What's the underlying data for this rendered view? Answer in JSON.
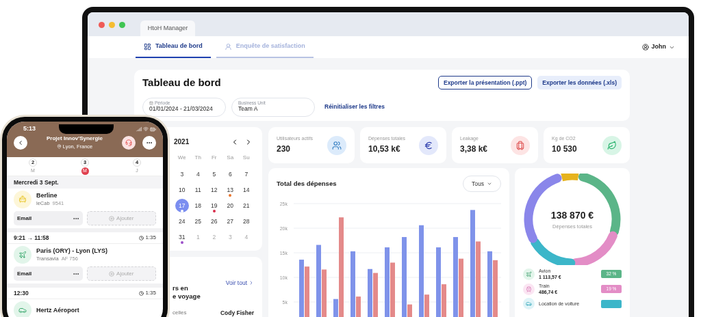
{
  "laptop": {
    "window_tab": "HtoH Manager",
    "nav_tabs": [
      {
        "label": "Tableau de bord",
        "selected": true
      },
      {
        "label": "Enquête de satisfaction",
        "selected": false
      }
    ],
    "user": "John",
    "header": {
      "title": "Tableau de bord",
      "buttons": [
        {
          "label": "Exporter la présentation (.ppt)",
          "kind": "outline"
        },
        {
          "label": "Exporter les données (.xls)",
          "kind": "soft"
        }
      ],
      "filters": [
        {
          "label": "Période",
          "value": "01/01/2024 - 21/03/2024"
        },
        {
          "label": "Business Unit",
          "value": "Team A"
        }
      ],
      "reset": "Réinitialiser les filtres"
    },
    "calendar": {
      "year": "2021",
      "weekdays": [
        "We",
        "Th",
        "Fr",
        "Sa",
        "Su"
      ],
      "weeks": [
        [
          {
            "day": "3",
            "selected": false,
            "muted": false
          },
          {
            "day": "4",
            "selected": false,
            "muted": false
          },
          {
            "day": "5",
            "selected": false,
            "muted": false
          },
          {
            "day": "6",
            "selected": false,
            "muted": false
          },
          {
            "day": "7",
            "selected": false,
            "muted": false
          }
        ],
        [
          {
            "day": "10",
            "selected": false,
            "muted": false
          },
          {
            "day": "11",
            "selected": false,
            "muted": false
          },
          {
            "day": "12",
            "selected": false,
            "muted": false
          },
          {
            "day": "13",
            "selected": false,
            "muted": false,
            "color": "#e8742c"
          },
          {
            "day": "14",
            "selected": false,
            "muted": false
          }
        ],
        [
          {
            "day": "17",
            "selected": true,
            "muted": false,
            "color": "#ffffff"
          },
          {
            "day": "18",
            "selected": false,
            "muted": false
          },
          {
            "day": "19",
            "selected": false,
            "muted": false,
            "color": "#d92d4b"
          },
          {
            "day": "20",
            "selected": false,
            "muted": false
          },
          {
            "day": "21",
            "selected": false,
            "muted": false
          }
        ],
        [
          {
            "day": "24",
            "selected": false,
            "muted": false
          },
          {
            "day": "25",
            "selected": false,
            "muted": false
          },
          {
            "day": "26",
            "selected": false,
            "muted": false
          },
          {
            "day": "27",
            "selected": false,
            "muted": false
          },
          {
            "day": "28",
            "selected": false,
            "muted": false
          }
        ],
        [
          {
            "day": "31",
            "selected": false,
            "muted": false,
            "color": "#9b4fc9"
          },
          {
            "day": "1",
            "selected": false,
            "muted": true
          },
          {
            "day": "2",
            "selected": false,
            "muted": true
          },
          {
            "day": "3",
            "selected": false,
            "muted": true
          },
          {
            "day": "4",
            "selected": false,
            "muted": true
          }
        ]
      ]
    },
    "travelers": {
      "title_lines": [
        "rs en",
        "e voyage"
      ],
      "link": "Voir tout",
      "column_1": "celles",
      "column_2": "Cody Fisher"
    },
    "stats": [
      {
        "label": "Utilisateurs actifs",
        "value": "230",
        "kind": "users"
      },
      {
        "label": "Dépenses totales",
        "value": "10,53 k€",
        "kind": "euro"
      },
      {
        "label": "Leakage",
        "value": "3,38 k€",
        "kind": "luggage"
      },
      {
        "label": "Kg de CO2",
        "value": "10 530",
        "kind": "leaf"
      }
    ],
    "chart": {
      "filter": "Tous",
      "chart_data": {
        "type": "bar",
        "title": "Total des dépenses",
        "grid": true,
        "ylim": [
          0,
          25000
        ],
        "yticks": [
          {
            "value": 5000,
            "label": "5k"
          },
          {
            "value": 10000,
            "label": "10k"
          },
          {
            "value": 15000,
            "label": "15k"
          },
          {
            "value": 20000,
            "label": "20k"
          },
          {
            "value": 25000,
            "label": "25k"
          }
        ],
        "series": [
          {
            "color": "#7f93ea",
            "values": [
              13600,
              16600,
              5600,
              15300,
              11700,
              16100,
              18200,
              20600,
              16100,
              18200,
              23700,
              15300
            ]
          },
          {
            "color": "#e48a8a",
            "values": [
              12200,
              11600,
              22200,
              6100,
              10900,
              13000,
              4500,
              6500,
              8600,
              13800,
              17300,
              13500
            ]
          }
        ]
      }
    },
    "donut": {
      "total": "138 870 €",
      "caption": "Dépenses totales",
      "legend": [
        {
          "name": "Avion",
          "amount": "1 113,57 €",
          "share": "32 %",
          "kind": "plane",
          "color": "#5bb588"
        },
        {
          "name": "Train",
          "amount": "486,74 €",
          "share": "19 %",
          "kind": "train",
          "color": "#e38dc6"
        },
        {
          "name": "Location de voiture",
          "kind": "car",
          "color": "#3cb6c9"
        }
      ]
    }
  },
  "phone": {
    "time": "5:13",
    "title": "Projet Innov'Synergie",
    "location": "Lyon, France",
    "days": [
      {
        "number": "2",
        "letter": "M",
        "selected": false
      },
      {
        "number": "3",
        "letter": "M",
        "selected": true
      },
      {
        "number": "4",
        "letter": "J",
        "selected": false
      }
    ],
    "date": "Mercredi 3 Sept.",
    "segments": [
      {
        "kind": "taxi",
        "name": "Berline",
        "company": "leCab",
        "code": "9541",
        "email": "Email",
        "add": "Ajouter"
      },
      {
        "kind": "header",
        "time": "9:21 → 11:58",
        "duration": "1:35"
      },
      {
        "kind": "flight",
        "name": "Paris (ORY) - Lyon (LYS)",
        "company": "Transavia",
        "code": "AF 756",
        "email": "Email",
        "add": "Ajouter"
      },
      {
        "kind": "header",
        "time": "12:30",
        "duration": "1:35"
      },
      {
        "kind": "car",
        "name": "Hertz Aéroport"
      }
    ]
  }
}
